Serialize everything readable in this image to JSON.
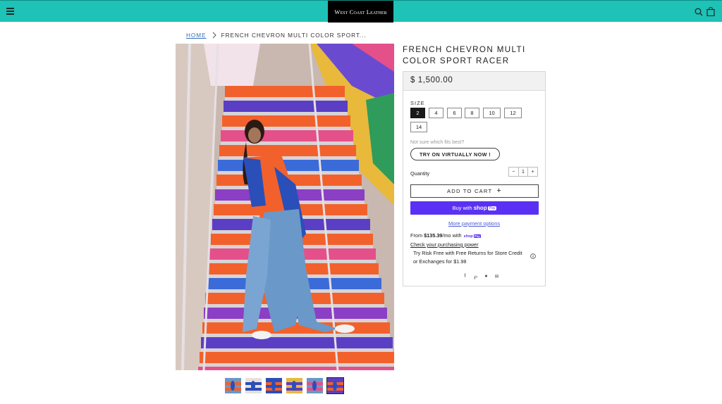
{
  "header": {
    "logo_text": "West Coast Leather",
    "menu_icon": "hamburger-menu-icon",
    "search_icon": "search-icon",
    "cart_icon": "shopping-bag-icon",
    "bar_color": "#1ec2b6"
  },
  "breadcrumb": {
    "home": "HOME",
    "current": "FRENCH CHEVRON MULTI COLOR SPORT..."
  },
  "product": {
    "title": "FRENCH CHEVRON MULTI COLOR SPORT RACER",
    "price": "$ 1,500.00",
    "size_label": "SIZE",
    "sizes": [
      "2",
      "4",
      "6",
      "8",
      "10",
      "12",
      "14"
    ],
    "selected_size": "2",
    "fit_note": "Not sure which fits best?",
    "try_on_label": "TRY ON VIRTUALLY NOW !",
    "quantity_label": "Quantity",
    "quantity_value": "1",
    "qty_minus": "−",
    "qty_plus": "+",
    "add_to_cart_label": "ADD TO CART",
    "buy_with_label": "Buy with",
    "buy_with_brand": "shop",
    "buy_with_badge": "Pay",
    "more_payment_label": "More payment options",
    "installment_prefix": "From ",
    "installment_amount": "$135.39",
    "installment_suffix": "/mo with ",
    "shoppay_mini": "shop",
    "shoppay_mini_badge": "Pay",
    "check_power_label": "Check your purchasing power",
    "risk_free_text": "Try Risk Free with Free Returns for Store Credit or Exchanges for $1.98",
    "share_icons": [
      "facebook-icon",
      "pinterest-icon",
      "fancy-icon",
      "email-icon"
    ],
    "accent_color": "#5a31f4"
  },
  "gallery": {
    "thumbnail_count": 6,
    "active_index": 5
  }
}
